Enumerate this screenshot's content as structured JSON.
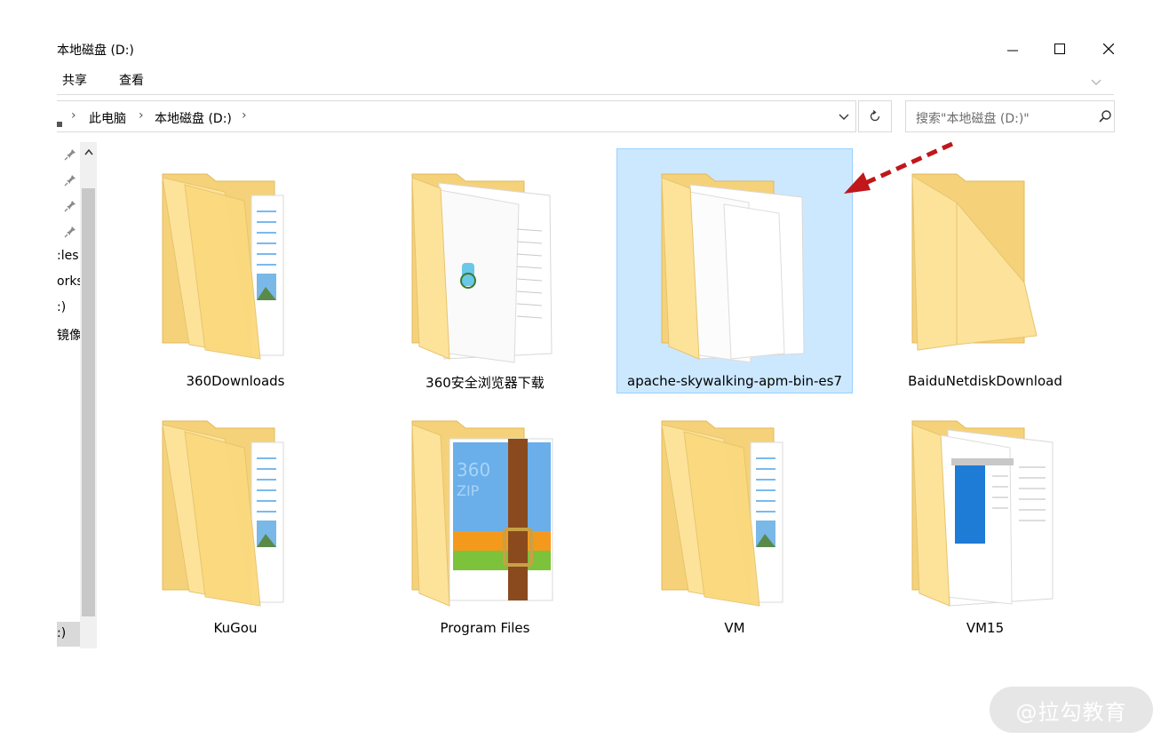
{
  "window": {
    "title": "本地磁盘 (D:)",
    "controls": [
      "minimize-icon",
      "maximize-icon",
      "close-icon"
    ]
  },
  "ribbon": {
    "tabs": [
      "共享",
      "查看"
    ]
  },
  "address": {
    "breadcrumb": [
      "此电脑",
      "本地磁盘 (D:)"
    ],
    "search_placeholder": "搜索\"本地磁盘 (D:)\""
  },
  "nav_pane": {
    "items": [
      ":les",
      "orks",
      ":)",
      "镜像"
    ],
    "selected_item": ":)"
  },
  "folders": [
    {
      "name": "360Downloads",
      "style": "documents"
    },
    {
      "name": "360安全浏览器下载",
      "style": "browser"
    },
    {
      "name": "apache-skywalking-apm-bin-es7",
      "style": "blank",
      "selected": true
    },
    {
      "name": "BaiduNetdiskDownload",
      "style": "empty"
    },
    {
      "name": "KuGou",
      "style": "documents"
    },
    {
      "name": "Program Files",
      "style": "archive"
    },
    {
      "name": "VM",
      "style": "documents"
    },
    {
      "name": "VM15",
      "style": "screenshots"
    }
  ],
  "annotation": {
    "arrow_color": "#c0171b"
  },
  "watermark": "@拉勾教育",
  "colors": {
    "selection_bg": "#cce8ff",
    "selection_border": "#99d1ff",
    "folder_back": "#f5d27a",
    "folder_front": "#fde39a"
  }
}
